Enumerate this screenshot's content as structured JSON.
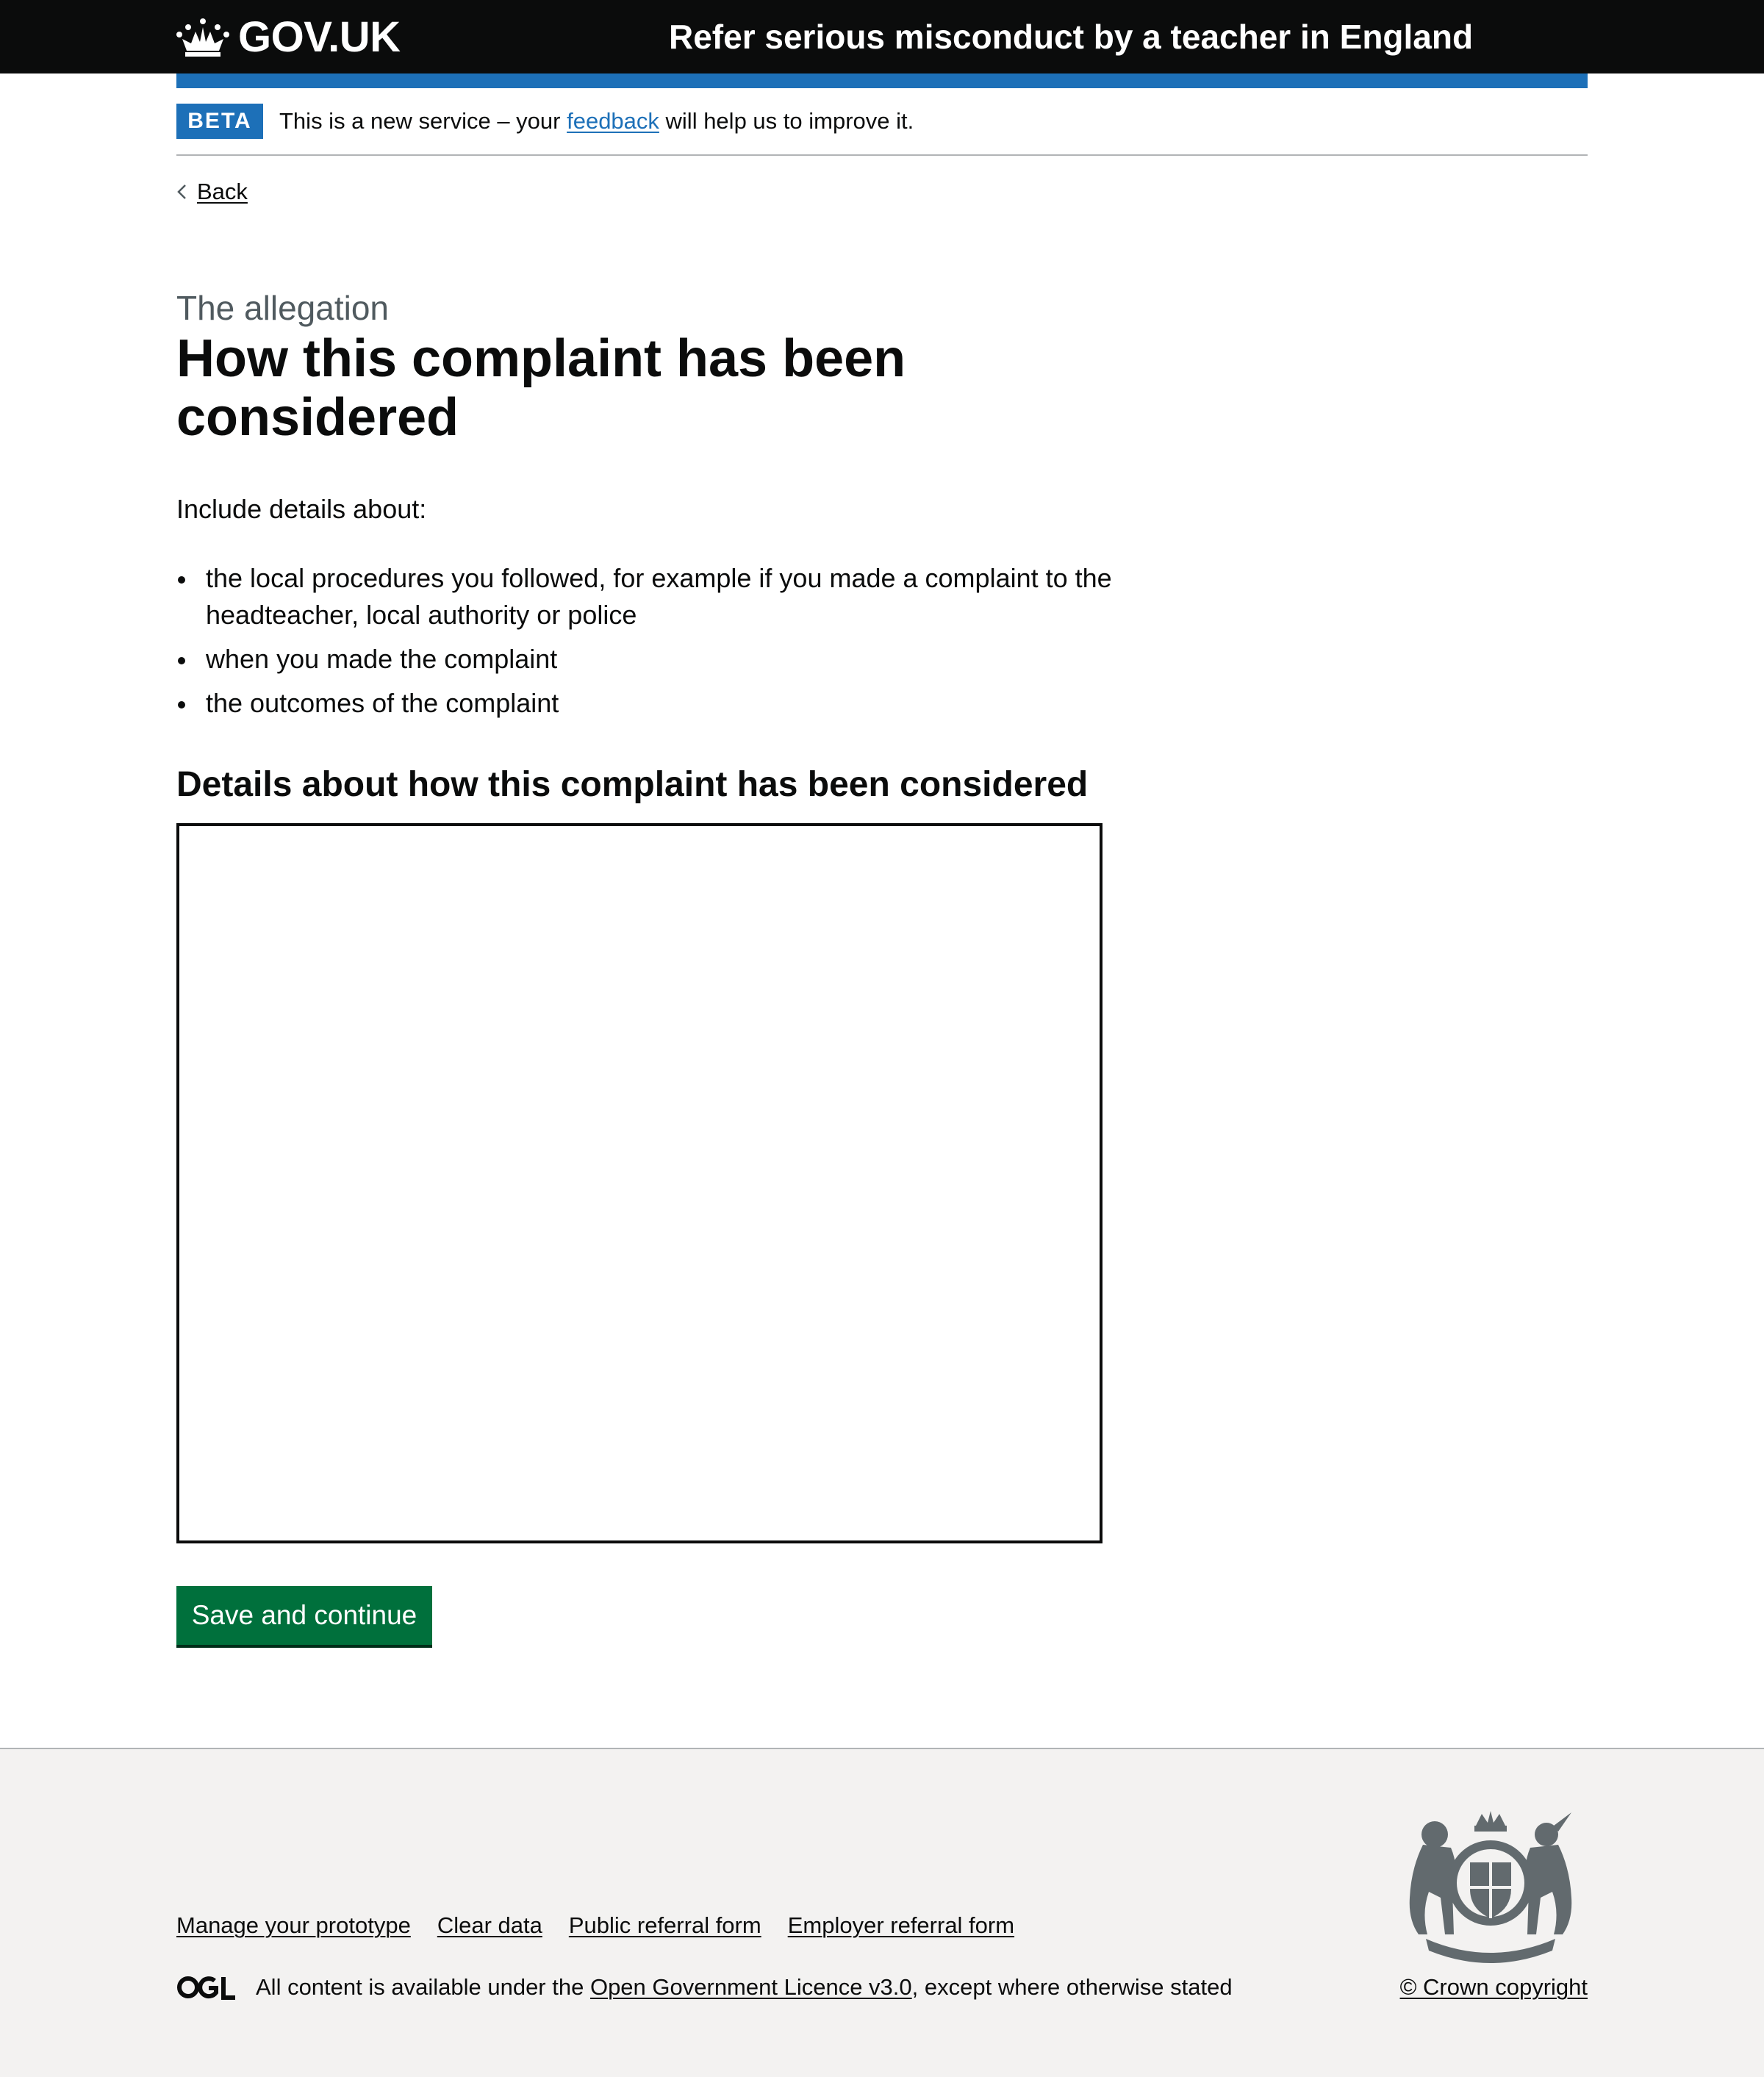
{
  "header": {
    "logo_text": "GOV.UK",
    "service_name": "Refer serious misconduct by a teacher in England"
  },
  "phase_banner": {
    "tag": "BETA",
    "text_before": "This is a new service – your ",
    "link": "feedback",
    "text_after": " will help us to improve it."
  },
  "back_link": "Back",
  "page": {
    "caption": "The allegation",
    "title": "How this complaint has been considered",
    "intro": "Include details about:",
    "bullets": [
      "the local procedures you followed, for example if you made a complaint to the headteacher, local authority or police",
      "when you made the complaint",
      "the outcomes of the complaint"
    ],
    "field_label": "Details about how this complaint has been considered",
    "field_value": "",
    "button_label": "Save and continue"
  },
  "footer": {
    "links": [
      "Manage your prototype",
      "Clear data",
      "Public referral form",
      "Employer referral form"
    ],
    "licence_before": "All content is available under the ",
    "licence_link": "Open Government Licence v3.0",
    "licence_after": ", except where otherwise stated",
    "copyright": "© Crown copyright"
  },
  "colors": {
    "header_bg": "#0b0c0c",
    "brand_blue": "#1d70b8",
    "button_green": "#00703c",
    "footer_bg": "#f3f2f1",
    "secondary_text": "#505a5f"
  },
  "icons": {
    "logo": "crown-icon",
    "back": "chevron-left-icon",
    "licence": "ogl-logo-icon",
    "crest": "royal-coat-of-arms-icon"
  }
}
